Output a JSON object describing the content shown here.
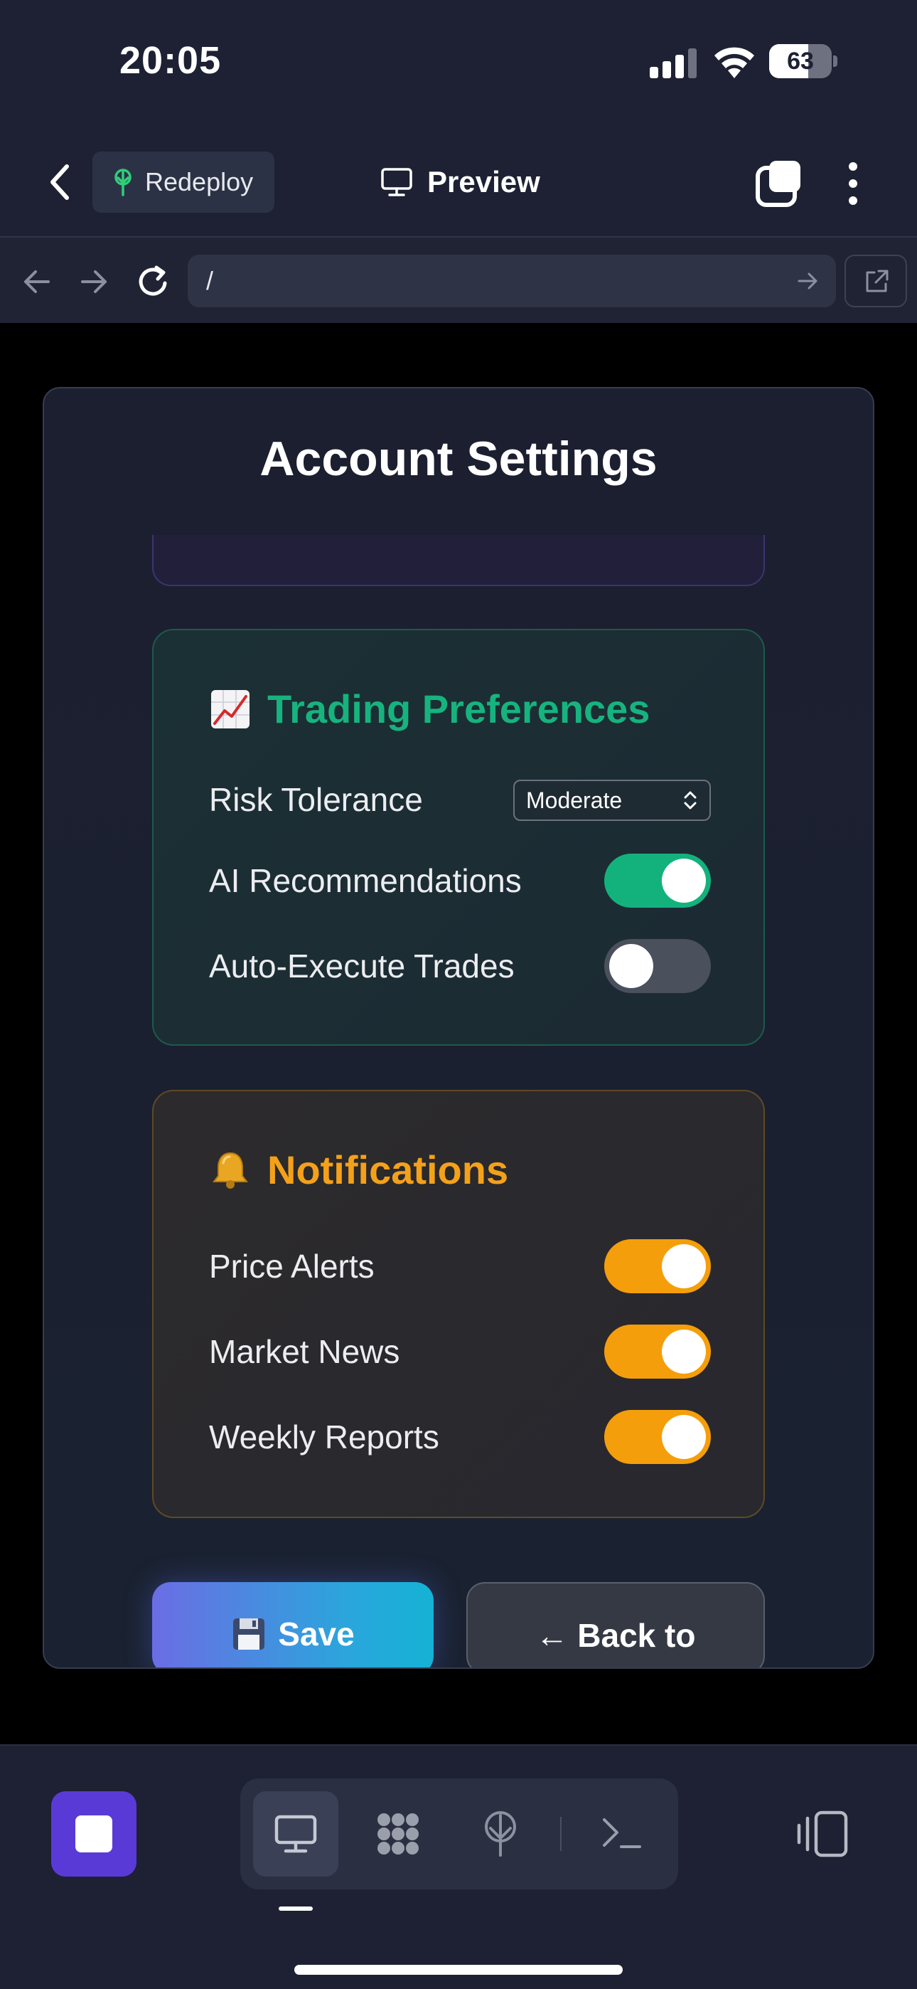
{
  "status_bar": {
    "time": "20:05",
    "battery_level": "63",
    "battery_fraction": 0.63
  },
  "top_bar": {
    "back_icon": "chevron-left-icon",
    "redeploy_label": "Redeploy",
    "preview_label": "Preview",
    "tabs_icon": "tabs-icon",
    "more_icon": "more-vertical-icon"
  },
  "url_bar": {
    "url": "/"
  },
  "page": {
    "title": "Account Settings",
    "trading": {
      "icon": "chart-increasing-icon",
      "title": "Trading Preferences",
      "risk_label": "Risk Tolerance",
      "risk_value": "Moderate",
      "ai_label": "AI Recommendations",
      "ai_on": true,
      "auto_label": "Auto-Execute Trades",
      "auto_on": false
    },
    "notifications": {
      "icon": "bell-icon",
      "title": "Notifications",
      "price_label": "Price Alerts",
      "price_on": true,
      "news_label": "Market News",
      "news_on": true,
      "weekly_label": "Weekly Reports",
      "weekly_on": true
    },
    "save_label": "Save",
    "back_label": "← Back to"
  },
  "colors": {
    "accent_green": "#13b27c",
    "accent_orange": "#f59e0b",
    "stop_purple": "#5a3ad6",
    "background": "#1d2133"
  }
}
